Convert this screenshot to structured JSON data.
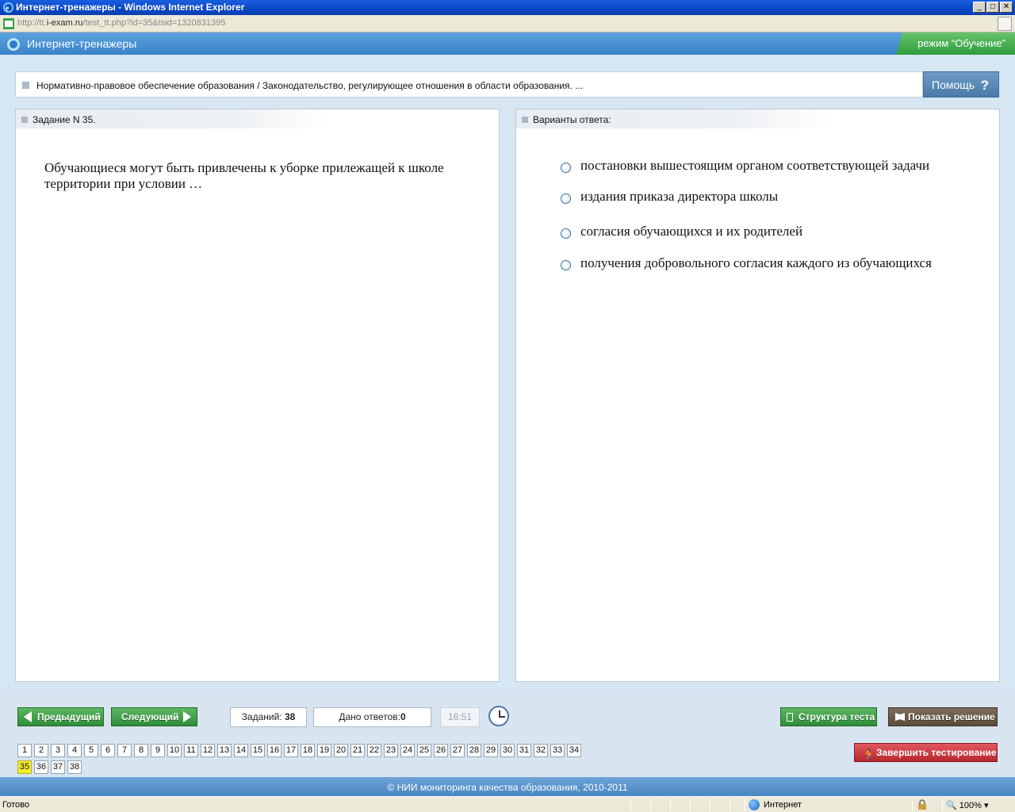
{
  "window": {
    "title": "Интернет-тренажеры - Windows Internet Explorer",
    "minimize": "_",
    "maximize": "□",
    "close": "✕"
  },
  "address": {
    "url_prefix": "http://tt.",
    "url_domain": "i-exam.ru",
    "url_path": "/test_tt.php?id=35&tsid=1320831395"
  },
  "app": {
    "title": "Интернет-тренажеры",
    "mode": "режим “Обучение”"
  },
  "breadcrumb": {
    "text": "Нормативно-правовое обеспечение образования / Законодательство, регулирующее отношения в области образования. ..."
  },
  "help": {
    "label": "Помощь",
    "icon": "?"
  },
  "task": {
    "header": "Задание N 35.",
    "question": "Обучающиеся могут быть привлечены к уборке прилежащей к школе территории при условии …"
  },
  "answers": {
    "header": "Варианты ответа:",
    "options": [
      "постановки вышестоящим органом соответствующей задачи",
      "издания приказа директора школы",
      "согласия обучающихся и их родителей",
      "получения добровольного согласия каждого из обучающихся"
    ]
  },
  "nav": {
    "prev": "Предыдущий",
    "next": "Следующий",
    "tasks_label": "Заданий:",
    "tasks_count": "38",
    "answered_label": "Дано ответов:",
    "answered_count": "0",
    "timer": "16:51",
    "structure": "Структура теста",
    "solution": "Показать решение",
    "finish": "Завершить тестирование",
    "current": "35",
    "numbers": [
      "1",
      "2",
      "3",
      "4",
      "5",
      "6",
      "7",
      "8",
      "9",
      "10",
      "11",
      "12",
      "13",
      "14",
      "15",
      "16",
      "17",
      "18",
      "19",
      "20",
      "21",
      "22",
      "23",
      "24",
      "25",
      "26",
      "27",
      "28",
      "29",
      "30",
      "31",
      "32",
      "33",
      "34",
      "35",
      "36",
      "37",
      "38"
    ]
  },
  "footer": {
    "text": "© НИИ мониторинга качества образования, 2010-2011"
  },
  "statusbar": {
    "ready": "Готово",
    "zone": "Интернет",
    "zoom": "100%"
  },
  "colors": {
    "header_blue": "#3a83c8",
    "mode_green": "#2f9c3c",
    "current_task": "#f3ef2a",
    "finish_red": "#b8282f"
  }
}
